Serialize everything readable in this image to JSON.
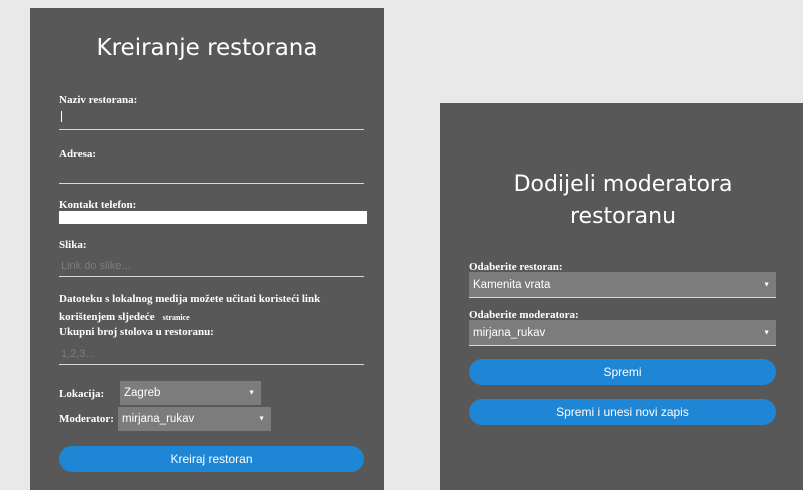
{
  "create_form": {
    "title": "Kreiranje restorana",
    "name_label": "Naziv restorana:",
    "name_value": "",
    "address_label": "Adresa:",
    "address_value": "",
    "phone_label": "Kontakt telefon:",
    "phone_value": "",
    "image_label": "Slika:",
    "image_placeholder": "Link do slike...",
    "upload_note": "Datoteku s lokalnog medija možete učitati koristeći link korištenjem sljedeće",
    "upload_link": "stranice",
    "tables_label": "Ukupni broj stolova u restoranu:",
    "tables_placeholder": "1,2,3...",
    "location_label": "Lokacija:",
    "location_value": "Zagreb",
    "moderator_label": "Moderator:",
    "moderator_value": "mirjana_rukav",
    "submit_label": "Kreiraj restoran"
  },
  "assign_form": {
    "title": "Dodijeli moderatora restoranu",
    "restaurant_label": "Odaberite restoran:",
    "restaurant_value": "Kamenita vrata",
    "moderator_label": "Odaberite moderatora:",
    "moderator_value": "mirjana_rukav",
    "save_label": "Spremi",
    "save_new_label": "Spremi i unesi novi zapis"
  },
  "colors": {
    "panel": "#585858",
    "background": "#e9e9ea",
    "button": "#1e86d4",
    "select": "#7c7c7c"
  }
}
